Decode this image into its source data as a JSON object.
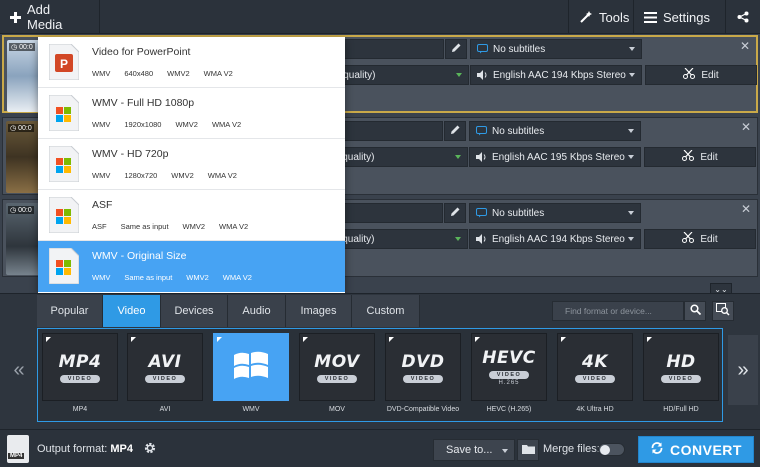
{
  "topbar": {
    "add_media": "Add Media",
    "tools": "Tools",
    "settings": "Settings"
  },
  "files": [
    {
      "duration": "00:0",
      "format": "mp4",
      "quality": "Good quality)",
      "subtitles": "No subtitles",
      "audio": "English AAC 194 Kbps Stereo",
      "edit": "Edit"
    },
    {
      "duration": "00:0",
      "format": "4",
      "quality": "Good quality)",
      "subtitles": "No subtitles",
      "audio": "English AAC 195 Kbps Stereo",
      "edit": "Edit"
    },
    {
      "duration": "00:0",
      "format": "p4",
      "quality": "Good quality)",
      "subtitles": "No subtitles",
      "audio": "English AAC 194 Kbps Stereo",
      "edit": "Edit"
    }
  ],
  "dropdown": {
    "items": [
      {
        "title": "Video for PowerPoint",
        "specs": [
          "WMV",
          "640x480",
          "WMV2",
          "WMA V2"
        ],
        "icon": "powerpoint-icon"
      },
      {
        "title": "WMV - Full HD 1080p",
        "specs": [
          "WMV",
          "1920x1080",
          "WMV2",
          "WMA V2"
        ],
        "icon": "windows-icon"
      },
      {
        "title": "WMV - HD 720p",
        "specs": [
          "WMV",
          "1280x720",
          "WMV2",
          "WMA V2"
        ],
        "icon": "windows-icon"
      },
      {
        "title": "ASF",
        "specs": [
          "ASF",
          "Same as input",
          "WMV2",
          "WMA V2"
        ],
        "icon": "windows-icon"
      },
      {
        "title": "WMV - Original Size",
        "specs": [
          "WMV",
          "Same as input",
          "WMV2",
          "WMA V2"
        ],
        "icon": "windows-icon"
      }
    ],
    "active_index": 4
  },
  "tabs": [
    "Popular",
    "Video",
    "Devices",
    "Audio",
    "Images",
    "Custom"
  ],
  "active_tab": "Video",
  "search": {
    "placeholder": "Find format or device..."
  },
  "formats": [
    {
      "big": "MP4",
      "pill": "VIDEO",
      "label": "MP4"
    },
    {
      "big": "AVI",
      "pill": "VIDEO",
      "label": "AVI"
    },
    {
      "big": "",
      "pill": "",
      "label": "WMV"
    },
    {
      "big": "MOV",
      "pill": "VIDEO",
      "label": "MOV"
    },
    {
      "big": "DVD",
      "pill": "VIDEO",
      "label": "DVD-Compatible Video"
    },
    {
      "big": "HEVC",
      "pill": "VIDEO",
      "sub": "H.265",
      "label": "HEVC (H.265)"
    },
    {
      "big": "4K",
      "pill": "VIDEO",
      "label": "4K Ultra HD"
    },
    {
      "big": "HD",
      "pill": "VIDEO",
      "label": "HD/Full HD"
    }
  ],
  "footer": {
    "output_label": "Output format:",
    "output_value": "MP4",
    "output_badge": "MP4",
    "save_to": "Save to...",
    "merge_files": "Merge files:",
    "convert": "CONVERT"
  },
  "colors": {
    "accent": "#2f9ae5",
    "selected_border": "#c9a949",
    "dropdown_active": "#47a3f3"
  }
}
